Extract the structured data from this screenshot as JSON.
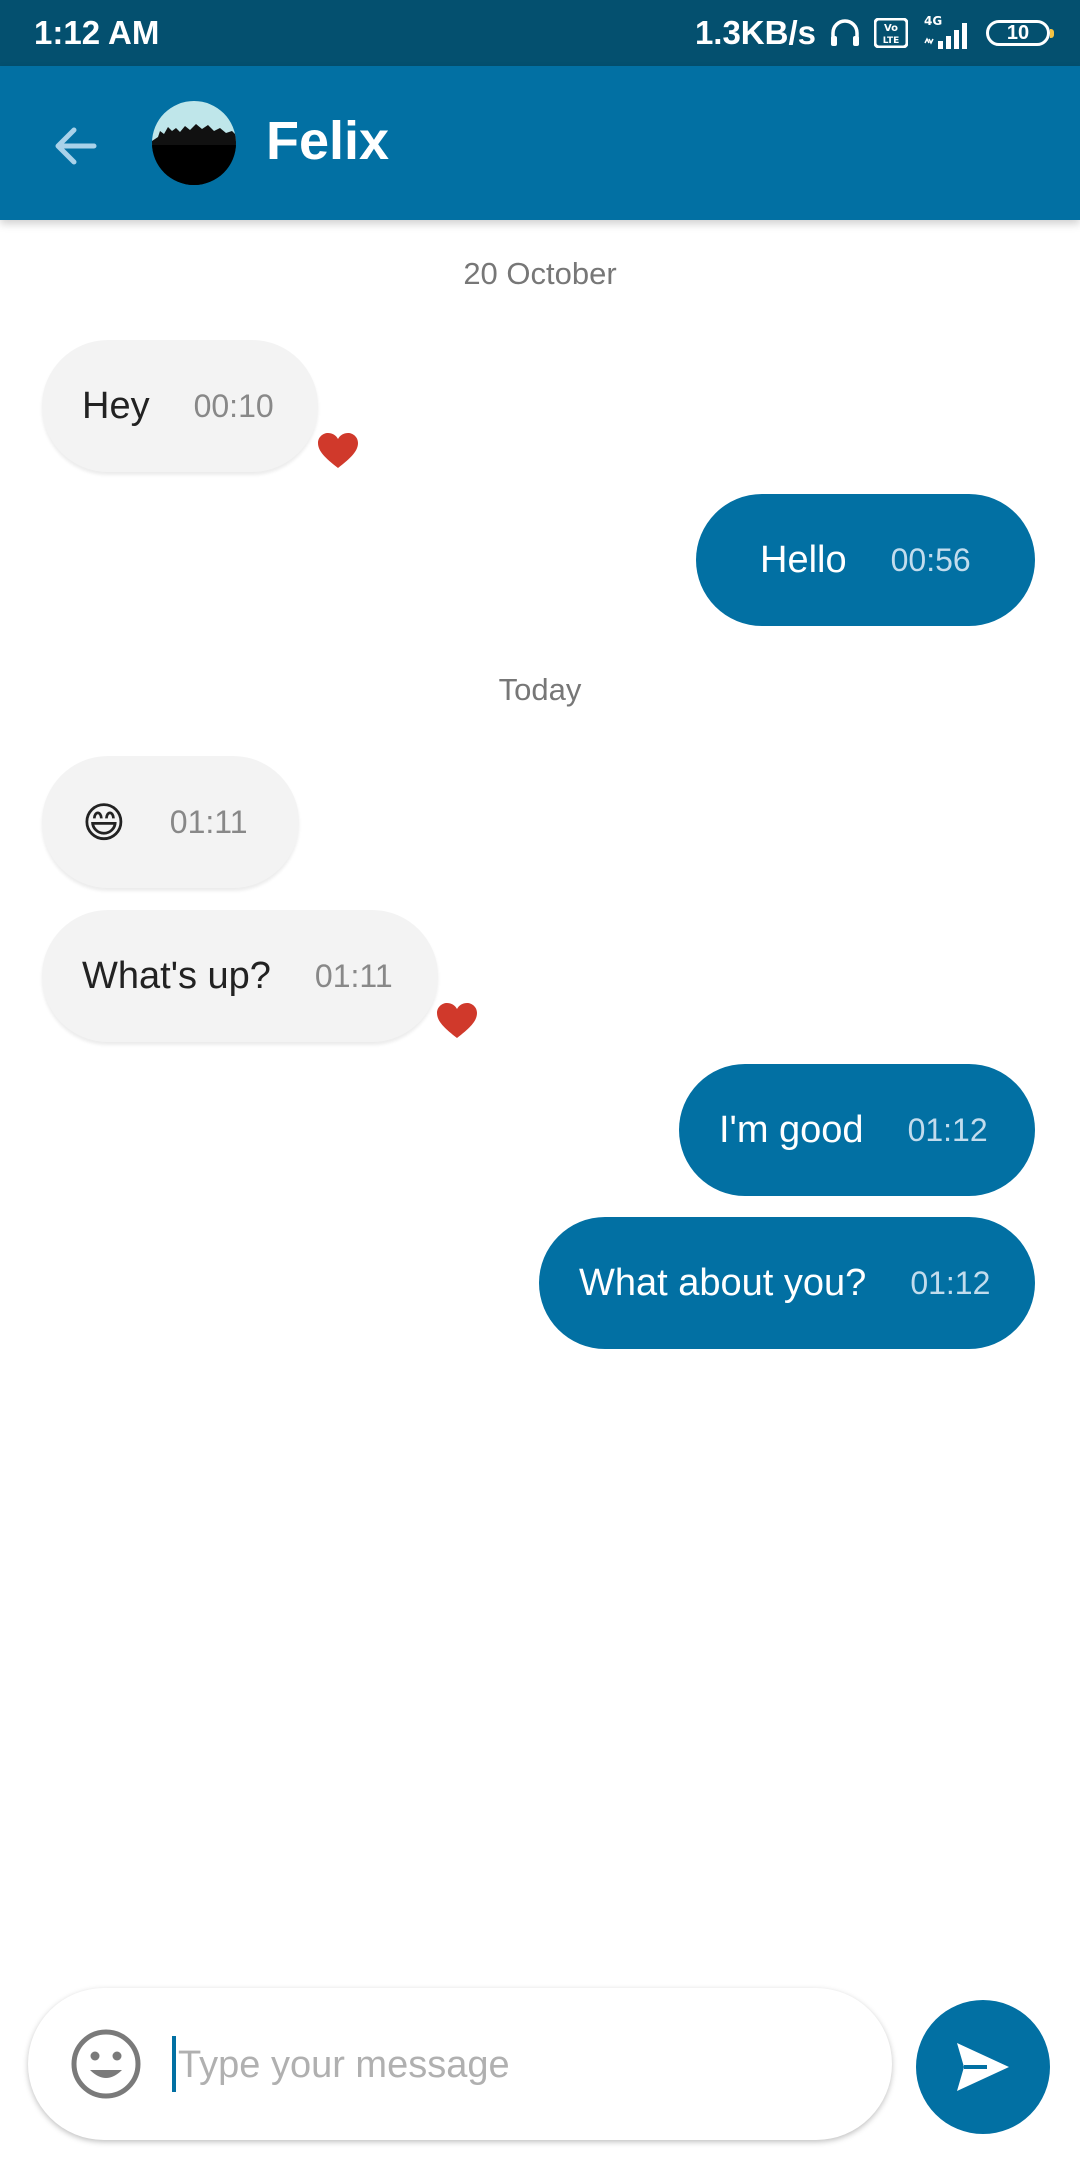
{
  "status_bar": {
    "time": "1:12 AM",
    "net_speed": "1.3KB/s",
    "network": "4G",
    "battery": "10",
    "icons": [
      "headphones-icon",
      "volte-icon",
      "signal-icon",
      "battery-icon"
    ]
  },
  "header": {
    "contact_name": "Felix",
    "back_icon": "arrow-left-icon",
    "bg_color": "#0270a3"
  },
  "chat": {
    "date_separators": [
      "20 October",
      "Today"
    ],
    "messages": [
      {
        "direction": "incoming",
        "text": "Hey",
        "time": "00:10",
        "liked": true
      },
      {
        "direction": "outgoing",
        "text": "Hello",
        "time": "00:56",
        "liked": false
      },
      {
        "direction": "incoming",
        "text": "😄",
        "time": "01:11",
        "liked": false
      },
      {
        "direction": "incoming",
        "text": "What's up?",
        "time": "01:11",
        "liked": true
      },
      {
        "direction": "outgoing",
        "text": "I'm good",
        "time": "01:12",
        "liked": false
      },
      {
        "direction": "outgoing",
        "text": "What about you?",
        "time": "01:12",
        "liked": false
      }
    ]
  },
  "composer": {
    "placeholder": "Type your message",
    "value": "",
    "emoji_icon": "smiley-icon",
    "send_icon": "send-icon"
  },
  "colors": {
    "accent": "#0270a3",
    "status_bar": "#04506f",
    "incoming_bubble": "#f3f3f3",
    "heart": "#d0392b"
  }
}
